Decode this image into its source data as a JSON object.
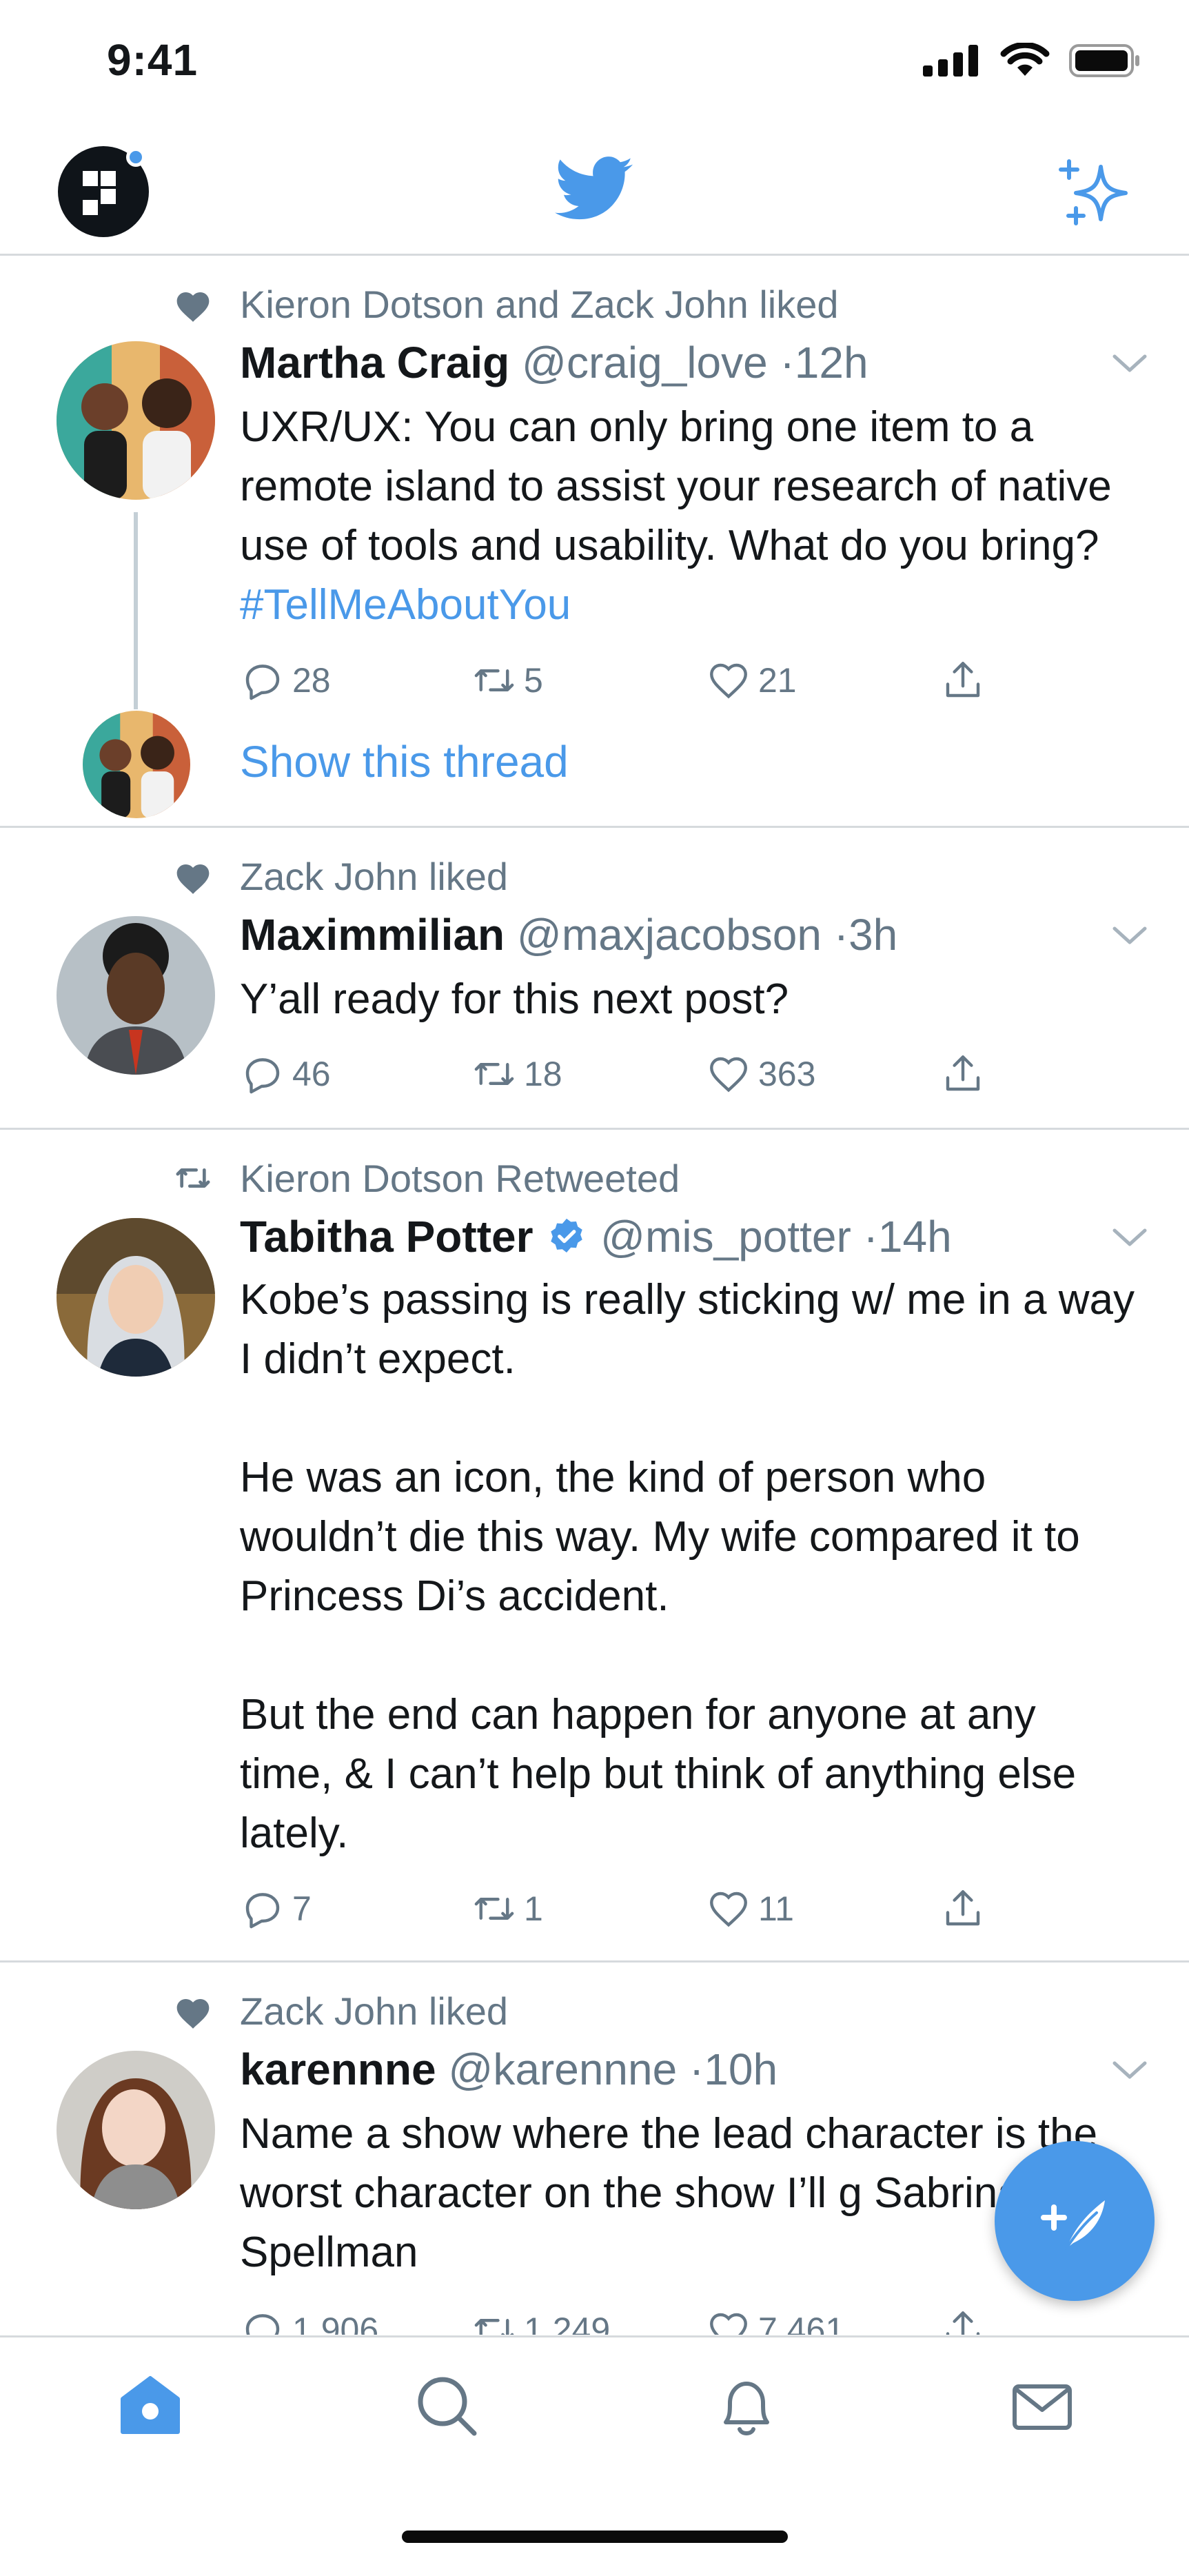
{
  "status_bar": {
    "time": "9:41"
  },
  "colors": {
    "accent": "#4A99E9",
    "text": "#14171A",
    "secondary": "#657786",
    "divider": "#D6DADD"
  },
  "header": {
    "profile_icon": "profile-avatar-icon",
    "logo_icon": "twitter-bird-icon",
    "timeline_icon": "sparkle-icon"
  },
  "tweets": [
    {
      "context": "Kieron Dotson and Zack John liked",
      "context_icon": "heart-icon",
      "name": "Martha Craig",
      "handle": "@craig_love",
      "time": "·12h",
      "text_before_tag": "UXR/UX: You can only bring one item to a remote island to assist your research of native use of tools and usability. What do you bring? ",
      "hashtag": "#TellMeAboutYou",
      "replies": "28",
      "retweets": "5",
      "likes": "21",
      "thread_link": "Show this thread"
    },
    {
      "context": "Zack John liked",
      "context_icon": "heart-icon",
      "name": "Maximmilian",
      "handle": "@maxjacobson",
      "time": "·3h",
      "text": "Y’all ready for this next post?",
      "replies": "46",
      "retweets": "18",
      "likes": "363"
    },
    {
      "context": "Kieron Dotson Retweeted",
      "context_icon": "retweet-icon",
      "name": "Tabitha Potter",
      "handle": "@mis_potter",
      "time": "·14h",
      "text": "Kobe’s passing is really sticking w/ me in a way I didn’t expect.\n\nHe was an icon, the kind of person who wouldn’t die this way. My wife compared it to Princess Di’s accident.\n\nBut the end can happen for anyone at any time, & I can’t help but think of anything else lately.",
      "replies": "7",
      "retweets": "1",
      "likes": "11"
    },
    {
      "context": "Zack John liked",
      "context_icon": "heart-icon",
      "name": "karennne",
      "handle": "@karennne",
      "time": "·10h",
      "text": "Name a show where the lead character is the worst character on the show I’ll g Sabrina Spellman",
      "replies": "1 906",
      "retweets": "1 249",
      "likes": "7 461"
    }
  ],
  "tab_bar": {
    "items": [
      "home-icon",
      "search-icon",
      "notifications-icon",
      "messages-icon"
    ],
    "active": "home-icon"
  }
}
